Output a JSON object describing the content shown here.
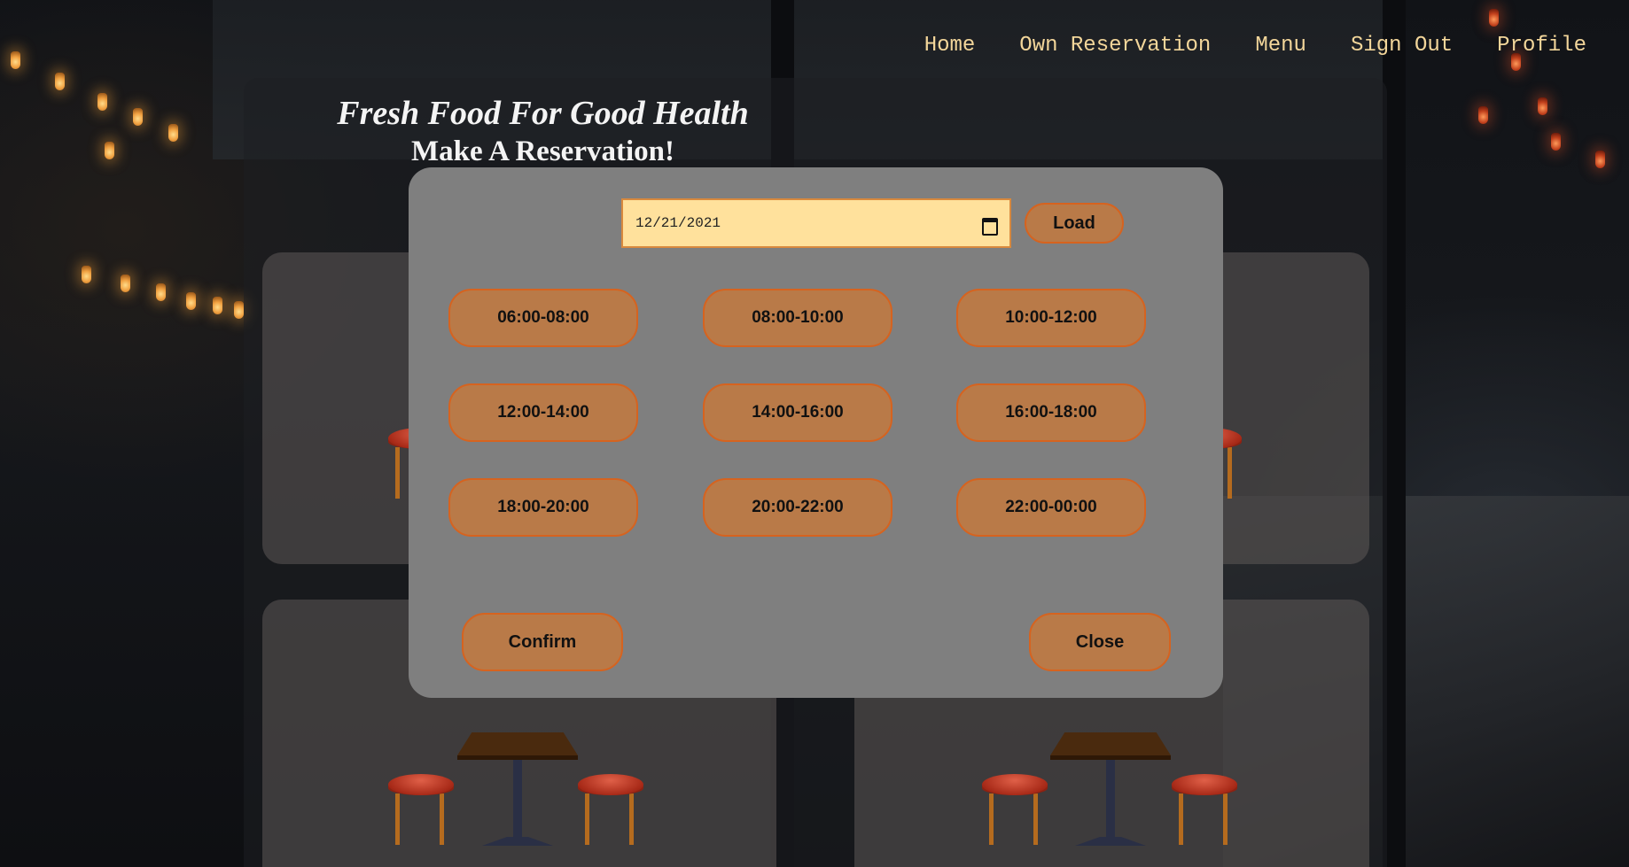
{
  "nav": {
    "items": [
      "Home",
      "Own Reservation",
      "Menu",
      "Sign Out",
      "Profile"
    ]
  },
  "hero": {
    "tagline": "Fresh Food For Good Health",
    "heading": "Make A Reservation!"
  },
  "modal": {
    "date_value": "12/21/2021",
    "load_label": "Load",
    "time_slots": [
      "06:00-08:00",
      "08:00-10:00",
      "10:00-12:00",
      "12:00-14:00",
      "14:00-16:00",
      "16:00-18:00",
      "18:00-20:00",
      "20:00-22:00",
      "22:00-00:00"
    ],
    "confirm_label": "Confirm",
    "close_label": "Close"
  },
  "colors": {
    "nav_text": "#f3d69a",
    "button_fill": "#b97a48",
    "button_border": "#d6631f",
    "date_fill": "#ffe19c",
    "modal_bg": "#7f7f7f"
  }
}
